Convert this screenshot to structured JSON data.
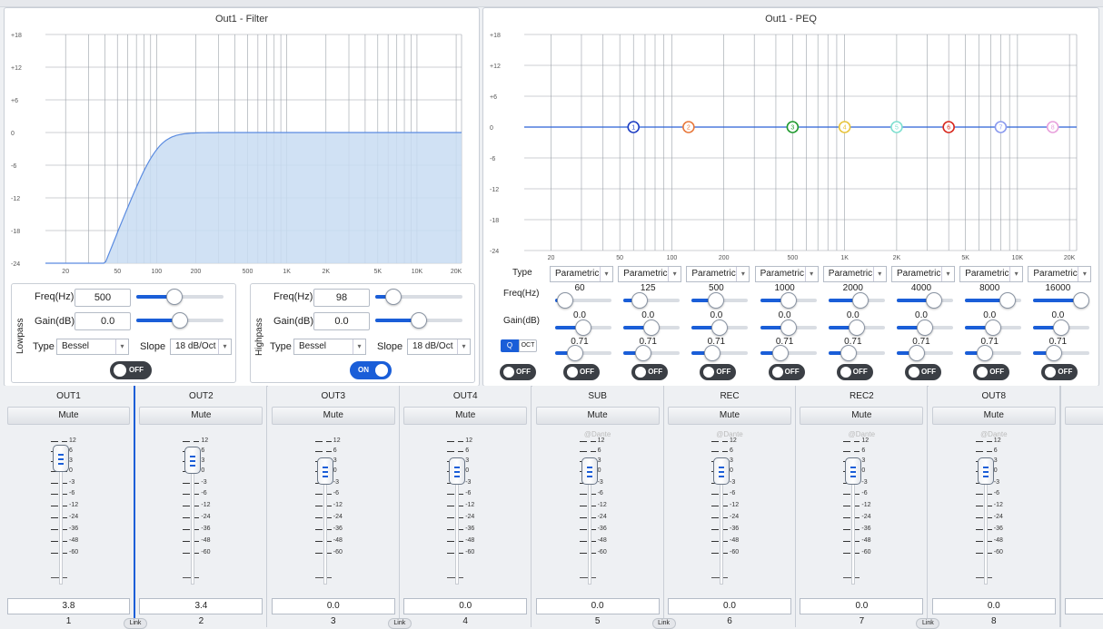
{
  "filter_panel": {
    "title": "Out1 - Filter",
    "y_ticks": [
      "+18",
      "+12",
      "+6",
      "0",
      "-6",
      "-12",
      "-18",
      "-24"
    ],
    "x_ticks": [
      "20",
      "50",
      "100",
      "200",
      "500",
      "1K",
      "2K",
      "5K",
      "10K",
      "20K"
    ],
    "curve_color": "#5a8be0",
    "fill_color": "#c8dcf2",
    "lowpass": {
      "section_label": "Lowpass",
      "freq_label": "Freq(Hz)",
      "freq_value": "500",
      "freq_level": 0.42,
      "gain_label": "Gain(dB)",
      "gain_value": "0.0",
      "gain_level": 0.5,
      "type_label": "Type",
      "type_value": "Bessel",
      "slope_label": "Slope",
      "slope_value": "18 dB/Oct",
      "toggle": "OFF"
    },
    "highpass": {
      "section_label": "Highpass",
      "freq_label": "Freq(Hz)",
      "freq_value": "98",
      "freq_level": 0.14,
      "gain_label": "Gain(dB)",
      "gain_value": "0.0",
      "gain_level": 0.5,
      "type_label": "Type",
      "type_value": "Bessel",
      "slope_label": "Slope",
      "slope_value": "18 dB/Oct",
      "toggle": "ON"
    }
  },
  "peq_panel": {
    "title": "Out1 - PEQ",
    "y_ticks": [
      "+18",
      "+12",
      "+6",
      "0",
      "-6",
      "-12",
      "-18",
      "-24"
    ],
    "x_ticks": [
      "20",
      "50",
      "100",
      "200",
      "500",
      "1K",
      "2K",
      "5K",
      "10K",
      "20K"
    ],
    "row_labels": {
      "type": "Type",
      "freq": "Freq(Hz)",
      "gain": "Gain(dB)",
      "q": "Q",
      "oct": "OCT"
    },
    "master_toggle": "OFF",
    "bands": [
      {
        "n": "1",
        "type": "Parametric",
        "freq": "60",
        "freq_level": 0.05,
        "gain": "0.0",
        "q": "0.71",
        "toggle": "OFF",
        "color": "#1f3fc4"
      },
      {
        "n": "2",
        "type": "Parametric",
        "freq": "125",
        "freq_level": 0.2,
        "gain": "0.0",
        "q": "0.71",
        "toggle": "OFF",
        "color": "#e8783c"
      },
      {
        "n": "3",
        "type": "Parametric",
        "freq": "500",
        "freq_level": 0.4,
        "gain": "0.0",
        "q": "0.71",
        "toggle": "OFF",
        "color": "#1f9a2e"
      },
      {
        "n": "4",
        "type": "Parametric",
        "freq": "1000",
        "freq_level": 0.5,
        "gain": "0.0",
        "q": "0.71",
        "toggle": "OFF",
        "color": "#e8c43c"
      },
      {
        "n": "5",
        "type": "Parametric",
        "freq": "2000",
        "freq_level": 0.6,
        "gain": "0.0",
        "q": "0.71",
        "toggle": "OFF",
        "color": "#7fe0d0"
      },
      {
        "n": "6",
        "type": "Parametric",
        "freq": "4000",
        "freq_level": 0.72,
        "gain": "0.0",
        "q": "0.71",
        "toggle": "OFF",
        "color": "#d8281e"
      },
      {
        "n": "7",
        "type": "Parametric",
        "freq": "8000",
        "freq_level": 0.86,
        "gain": "0.0",
        "q": "0.71",
        "toggle": "OFF",
        "color": "#8a9aee"
      },
      {
        "n": "8",
        "type": "Parametric",
        "freq": "16000",
        "freq_level": 1.0,
        "gain": "0.0",
        "q": "0.71",
        "toggle": "OFF",
        "color": "#e8a0dc"
      }
    ]
  },
  "mixer": {
    "mute_label": "Mute",
    "dante_label": "@Dante",
    "link_label": "Link",
    "scale": [
      "12",
      "6",
      "3",
      "0",
      "-3",
      "-6",
      "-12",
      "-24",
      "-36",
      "-48",
      "-60"
    ],
    "channels": [
      {
        "name": "OUT1",
        "value": "3.8",
        "num": "1",
        "dante": false,
        "level_db": 3.8,
        "selected": true
      },
      {
        "name": "OUT2",
        "value": "3.4",
        "num": "2",
        "dante": false,
        "level_db": 3.4,
        "selected": false
      },
      {
        "name": "OUT3",
        "value": "0.0",
        "num": "3",
        "dante": false,
        "level_db": 0,
        "selected": false
      },
      {
        "name": "OUT4",
        "value": "0.0",
        "num": "4",
        "dante": false,
        "level_db": 0,
        "selected": false
      },
      {
        "name": "SUB",
        "value": "0.0",
        "num": "5",
        "dante": true,
        "level_db": 0,
        "selected": false
      },
      {
        "name": "REC",
        "value": "0.0",
        "num": "6",
        "dante": true,
        "level_db": 0,
        "selected": false
      },
      {
        "name": "REC2",
        "value": "0.0",
        "num": "7",
        "dante": true,
        "level_db": 0,
        "selected": false
      },
      {
        "name": "OUT8",
        "value": "0.0",
        "num": "8",
        "dante": true,
        "level_db": 0,
        "selected": false
      }
    ]
  }
}
